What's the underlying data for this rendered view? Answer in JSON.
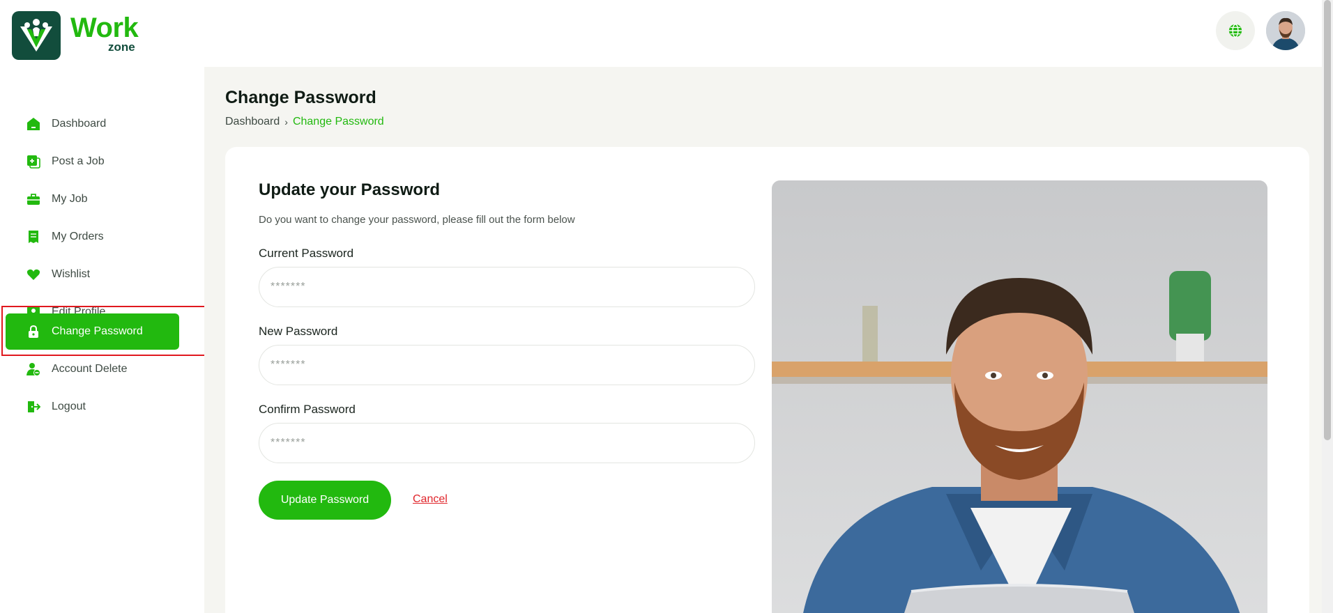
{
  "brand": {
    "name_primary": "Work",
    "name_secondary": "zone",
    "colors": {
      "accent": "#22b90f",
      "dark": "#124d3c",
      "cancel": "#e0252b"
    }
  },
  "header": {
    "language_icon": "globe-icon",
    "avatar_icon": "user-avatar"
  },
  "sidebar": {
    "items": [
      {
        "label": "Dashboard",
        "icon": "house-icon",
        "active": false
      },
      {
        "label": "Post a Job",
        "icon": "add-document-icon",
        "active": false
      },
      {
        "label": "My Job",
        "icon": "briefcase-icon",
        "active": false
      },
      {
        "label": "My Orders",
        "icon": "receipt-icon",
        "active": false
      },
      {
        "label": "Wishlist",
        "icon": "heart-icon",
        "active": false
      },
      {
        "label": "Edit Profile",
        "icon": "profile-card-icon",
        "active": false
      },
      {
        "label": "Change Password",
        "icon": "lock-icon",
        "active": true
      },
      {
        "label": "Account Delete",
        "icon": "user-remove-icon",
        "active": false
      },
      {
        "label": "Logout",
        "icon": "logout-icon",
        "active": false
      }
    ]
  },
  "page": {
    "title": "Change Password",
    "breadcrumb": {
      "home": "Dashboard",
      "separator": "›",
      "current": "Change Password"
    }
  },
  "form": {
    "title": "Update your Password",
    "description": "Do you want to change your password, please fill out the form below",
    "fields": [
      {
        "label": "Current Password",
        "placeholder": "*******",
        "value": ""
      },
      {
        "label": "New Password",
        "placeholder": "*******",
        "value": ""
      },
      {
        "label": "Confirm Password",
        "placeholder": "*******",
        "value": ""
      }
    ],
    "submit_label": "Update Password",
    "cancel_label": "Cancel"
  }
}
